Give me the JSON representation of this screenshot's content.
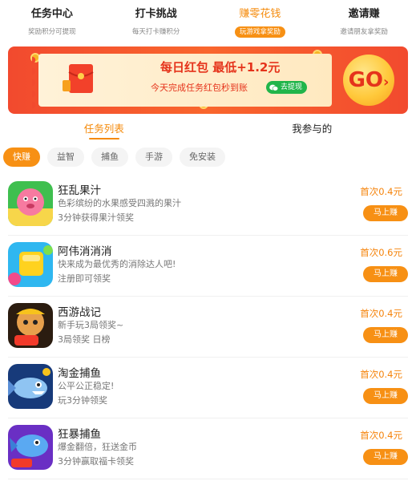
{
  "top_tabs": [
    {
      "title": "任务中心",
      "sub": "奖励积分可提现"
    },
    {
      "title": "打卡挑战",
      "sub": "每天打卡赚积分"
    },
    {
      "title": "赚零花钱",
      "sub": "玩游戏拿奖励"
    },
    {
      "title": "邀请赚",
      "sub": "邀请朋友拿奖励"
    }
  ],
  "banner": {
    "title": "每日红包 最低+1.2元",
    "subtitle": "今天完成任务红包秒到账",
    "withdraw_label": "去提现",
    "go_label": "GO",
    "go_arrow": "›"
  },
  "section_tabs": [
    "任务列表",
    "我参与的"
  ],
  "filters": [
    "快赚",
    "益智",
    "捕鱼",
    "手游",
    "免安装"
  ],
  "games": [
    {
      "name": "狂乱果汁",
      "desc": "色彩缤纷的水果感受四溅的果汁",
      "task": "3分钟获得果汁领奖",
      "price": "首次0.4元",
      "button": "马上赚"
    },
    {
      "name": "阿伟消消消",
      "desc": "快来成为最优秀的消除达人吧!",
      "task": "注册即可领奖",
      "price": "首次0.6元",
      "button": "马上赚"
    },
    {
      "name": "西游战记",
      "desc": "新手玩3局领奖~",
      "task": "3局领奖 日榜",
      "price": "首次0.4元",
      "button": "马上赚"
    },
    {
      "name": "淘金捕鱼",
      "desc": "公平公正稳定!",
      "task": "玩3分钟领奖",
      "price": "首次0.4元",
      "button": "马上赚"
    },
    {
      "name": "狂暴捕鱼",
      "desc": "爆金翻倍，狂送金币",
      "task": "3分钟赢取福卡领奖",
      "price": "首次0.4元",
      "button": "马上赚"
    }
  ],
  "icon_badges": {
    "red_packet": "有红包"
  },
  "colors": {
    "accent": "#f79014",
    "banner_red": "#f24a2e",
    "wechat_green": "#21b54a"
  }
}
